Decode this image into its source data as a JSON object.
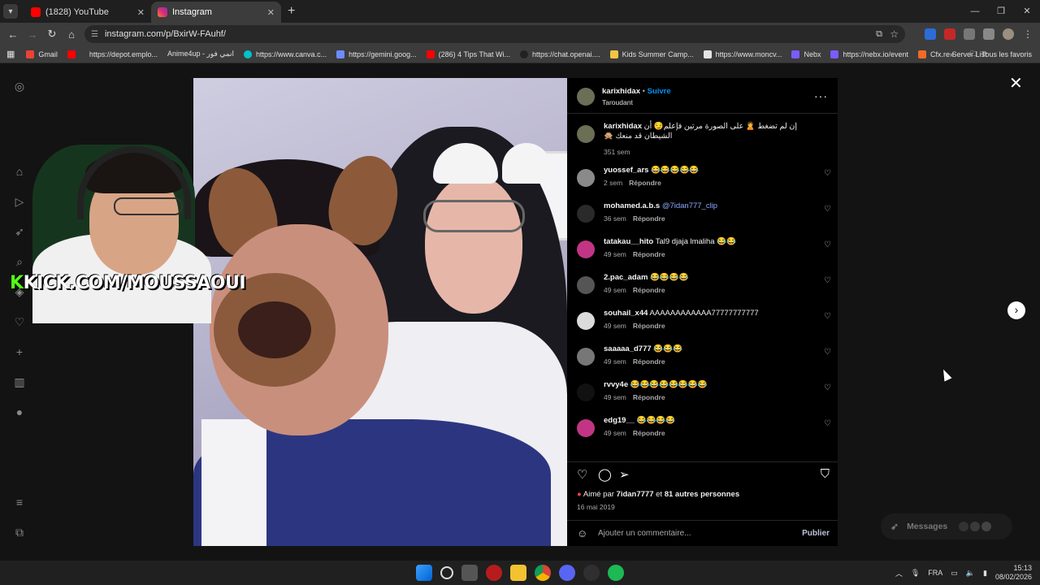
{
  "browser": {
    "tabs": [
      {
        "title": "(1828) YouTube",
        "active": false,
        "favicon_color": "#ff0000"
      },
      {
        "title": "Instagram",
        "active": true,
        "favicon_color": "#d62976"
      }
    ],
    "url": "instagram.com/p/BxirW-FAuhf/",
    "bookmarks": [
      {
        "label": "Gmail",
        "color": "#ea4335"
      },
      {
        "label": "",
        "color": "#ff0000"
      },
      {
        "label": "https://depot.emplo...",
        "color": "#4b4b4b"
      },
      {
        "label": "Anime4up - انمي فور",
        "color": "#4b4b4b"
      },
      {
        "label": "https://www.canva.c...",
        "color": "#00c4cc"
      },
      {
        "label": "https://gemini.goog...",
        "color": "#6c8cff"
      },
      {
        "label": "(286) 4 Tips That Wi...",
        "color": "#ff0000"
      },
      {
        "label": "https://chat.openai....",
        "color": "#222222"
      },
      {
        "label": "Kids Summer Camp...",
        "color": "#f4c542"
      },
      {
        "label": "https://www.moncv...",
        "color": "#e4e4e4"
      },
      {
        "label": "Nebx",
        "color": "#7b5cff"
      },
      {
        "label": "https://nebx.io/event",
        "color": "#7b5cff"
      },
      {
        "label": "Cfx.re Server List",
        "color": "#f06a25"
      }
    ],
    "bookmarks_all": "Tous les favoris"
  },
  "stream": {
    "kick_prefix": "K",
    "kick_rest": "KICK.COM/MOUSSAOUI"
  },
  "post": {
    "author": "karixhidax",
    "follow_label": "Suivre",
    "location": "Taroudant",
    "caption_user": "karixhidax",
    "caption_text": "إن لم تضغط 🙎 على الصورة مرتين فإعلم😏 أن الشيطان قد منعك 🙊",
    "caption_time": "351 sem",
    "reply_label": "Répondre",
    "comments": [
      {
        "user": "yuossef_ars",
        "text": "😂😂😂😂😂",
        "mention": "",
        "time": "2 sem",
        "avatar_color": "#8a8a8a"
      },
      {
        "user": "mohamed.a.b.s",
        "text": "",
        "mention": "@7idan777_clip",
        "time": "36 sem",
        "avatar_color": "#2a2a2a"
      },
      {
        "user": "tatakau__hito",
        "text": "Tal9 djaja lmaliha 😂😂",
        "mention": "",
        "time": "49 sem",
        "avatar_color": "#c13584"
      },
      {
        "user": "2.pac_adam",
        "text": "😂😂😂😂",
        "mention": "",
        "time": "49 sem",
        "avatar_color": "#555555"
      },
      {
        "user": "souhail_x44",
        "text": "AAAAAAAAAAAA77777777777",
        "mention": "",
        "time": "49 sem",
        "avatar_color": "#dbdbdb"
      },
      {
        "user": "saaaaa_d777",
        "text": "😂😂😂",
        "mention": "",
        "time": "49 sem",
        "avatar_color": "#777777"
      },
      {
        "user": "rvvy4e",
        "text": "😂😂😂😂😂😂😂😂",
        "mention": "",
        "time": "49 sem",
        "avatar_color": "#111111"
      },
      {
        "user": "edg19__",
        "text": "😂😂😂😂",
        "mention": "",
        "time": "49 sem",
        "avatar_color": "#c13584"
      }
    ],
    "likes_prefix": "Aimé par",
    "likes_user": "7idan7777",
    "likes_and": "et",
    "likes_others": "81 autres personnes",
    "date": "16 mai 2019",
    "add_comment_placeholder": "Ajouter un commentaire...",
    "publish_label": "Publier"
  },
  "messages": {
    "label": "Messages"
  },
  "taskbar": {
    "lang": "FRA",
    "time": "15:13",
    "date": "08/02/2026"
  },
  "colors": {
    "accent": "#0095f6",
    "kick_green": "#53fc18"
  }
}
